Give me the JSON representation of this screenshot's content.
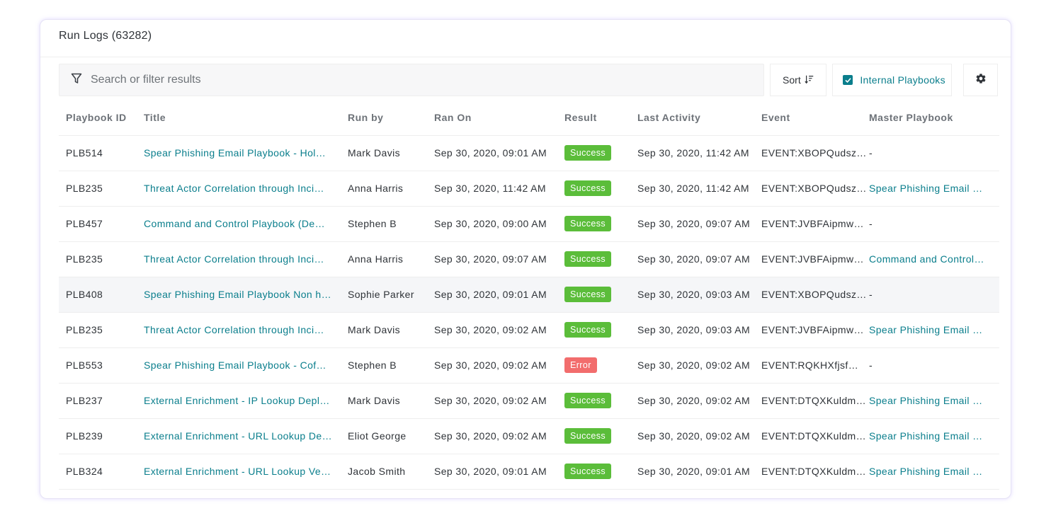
{
  "card": {
    "title": "Run Logs (63282)"
  },
  "toolbar": {
    "search_placeholder": "Search or filter results",
    "search_value": "",
    "sort_label": "Sort",
    "internal_label": "Internal Playbooks",
    "internal_checked": true
  },
  "colors": {
    "accent": "#0a7e8c",
    "success": "#5bbd3a",
    "error": "#f26d6d"
  },
  "table": {
    "columns": [
      "Playbook ID",
      "Title",
      "Run by",
      "Ran On",
      "Result",
      "Last Activity",
      "Event",
      "Master Playbook"
    ],
    "rows": [
      {
        "id": "PLB514",
        "title": "Spear Phishing Email Playbook - Hol…",
        "run_by": "Mark Davis",
        "ran_on": "Sep 30, 2020, 09:01 AM",
        "result": "Success",
        "last_activity": "Sep 30, 2020, 11:42 AM",
        "event": "EVENT:XBOPQudsz…",
        "master": "-"
      },
      {
        "id": "PLB235",
        "title": "Threat Actor Correlation through Inci…",
        "run_by": "Anna Harris",
        "ran_on": "Sep 30, 2020, 11:42 AM",
        "result": "Success",
        "last_activity": "Sep 30, 2020, 11:42 AM",
        "event": "EVENT:XBOPQudsz…",
        "master": "Spear Phishing Email …"
      },
      {
        "id": "PLB457",
        "title": "Command and Control Playbook (De…",
        "run_by": "Stephen B",
        "ran_on": "Sep 30, 2020, 09:00 AM",
        "result": "Success",
        "last_activity": "Sep 30, 2020, 09:07 AM",
        "event": "EVENT:JVBFAipmw…",
        "master": "-"
      },
      {
        "id": "PLB235",
        "title": "Threat Actor Correlation through Inci…",
        "run_by": "Anna Harris",
        "ran_on": "Sep 30, 2020, 09:07 AM",
        "result": "Success",
        "last_activity": "Sep 30, 2020, 09:07 AM",
        "event": "EVENT:JVBFAipmw…",
        "master": "Command and Control…"
      },
      {
        "id": "PLB408",
        "title": "Spear Phishing Email Playbook Non h…",
        "run_by": "Sophie Parker",
        "ran_on": "Sep 30, 2020, 09:01 AM",
        "result": "Success",
        "last_activity": "Sep 30, 2020, 09:03 AM",
        "event": "EVENT:XBOPQudsz…",
        "master": "-"
      },
      {
        "id": "PLB235",
        "title": "Threat Actor Correlation through Inci…",
        "run_by": "Mark Davis",
        "ran_on": "Sep 30, 2020, 09:02 AM",
        "result": "Success",
        "last_activity": "Sep 30, 2020, 09:03 AM",
        "event": "EVENT:JVBFAipmw…",
        "master": "Spear Phishing Email …"
      },
      {
        "id": "PLB553",
        "title": "Spear Phishing Email Playbook - Cof…",
        "run_by": "Stephen B",
        "ran_on": "Sep 30, 2020, 09:02 AM",
        "result": "Error",
        "last_activity": "Sep 30, 2020, 09:02 AM",
        "event": "EVENT:RQKHXfjsf…",
        "master": "-"
      },
      {
        "id": "PLB237",
        "title": "External Enrichment - IP Lookup Depl…",
        "run_by": "Mark Davis",
        "ran_on": "Sep 30, 2020, 09:02 AM",
        "result": "Success",
        "last_activity": "Sep 30, 2020, 09:02 AM",
        "event": "EVENT:DTQXKuldm…",
        "master": "Spear Phishing Email …"
      },
      {
        "id": "PLB239",
        "title": "External Enrichment - URL Lookup De…",
        "run_by": "Eliot George",
        "ran_on": "Sep 30, 2020, 09:02 AM",
        "result": "Success",
        "last_activity": "Sep 30, 2020, 09:02 AM",
        "event": "EVENT:DTQXKuldm…",
        "master": "Spear Phishing Email …"
      },
      {
        "id": "PLB324",
        "title": "External Enrichment - URL Lookup Ve…",
        "run_by": "Jacob Smith",
        "ran_on": "Sep 30, 2020, 09:01 AM",
        "result": "Success",
        "last_activity": "Sep 30, 2020, 09:01 AM",
        "event": "EVENT:DTQXKuldm…",
        "master": "Spear Phishing Email …"
      }
    ]
  },
  "icons": {
    "filter": "filter-icon",
    "sort": "sort-icon",
    "checkbox": "checkbox-checked-icon",
    "settings": "gear-icon"
  }
}
